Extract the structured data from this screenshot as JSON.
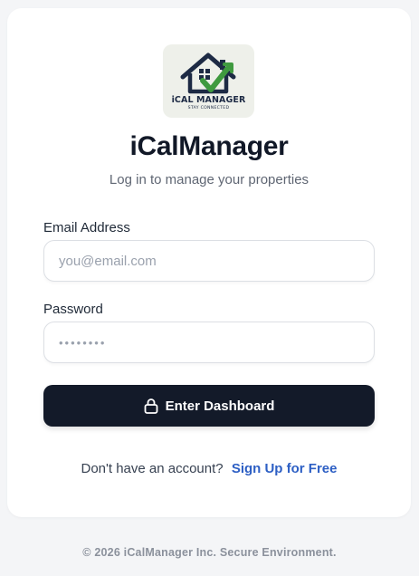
{
  "logo": {
    "name": "iCAL MANAGER",
    "tagline": "STAY CONNECTED"
  },
  "app_title": "iCalManager",
  "subtitle": "Log in to manage your properties",
  "form": {
    "email_label": "Email Address",
    "email_placeholder": "you@email.com",
    "password_label": "Password",
    "password_placeholder": "••••••••",
    "submit_label": "Enter Dashboard"
  },
  "signup": {
    "prompt": "Don't have an account?",
    "link": "Sign Up for Free"
  },
  "footer": "© 2026 iCalManager Inc. Secure Environment.",
  "colors": {
    "button_bg": "#131a29",
    "link": "#2d5fc4",
    "logo_navy": "#1d2a44",
    "logo_green": "#3f9a3f"
  },
  "icons": {
    "button": "lock-icon",
    "logo": "house-check-icon"
  }
}
